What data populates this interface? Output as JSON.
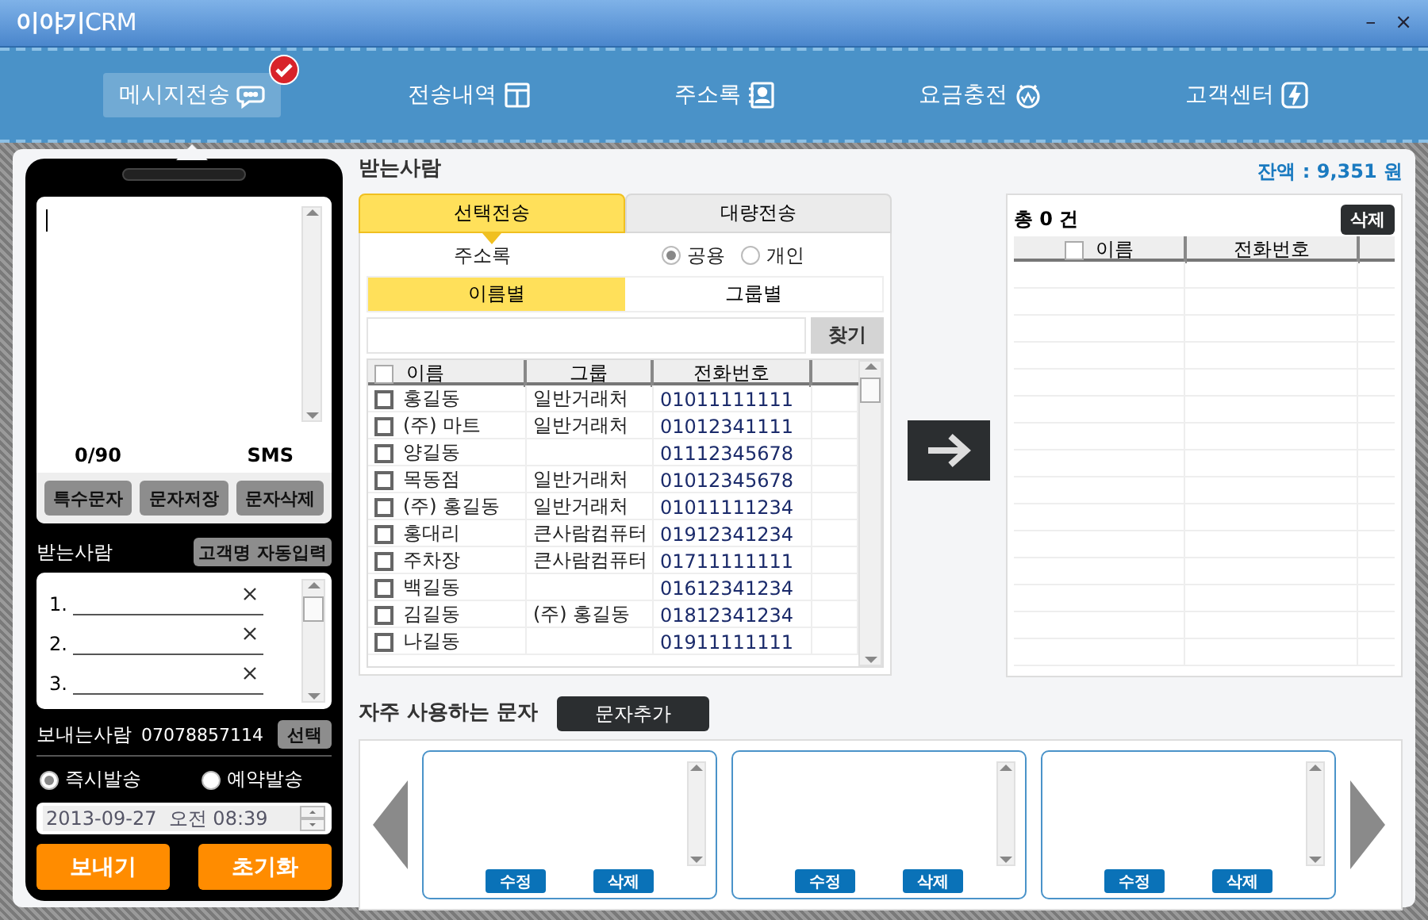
{
  "window": {
    "title": "**이야기**CRM",
    "controls": [
      "–",
      "×"
    ]
  },
  "nav": [
    {
      "label": "메시지전송",
      "selected": true
    },
    {
      "label": "전송내역",
      "selected": false
    },
    {
      "label": "주소록",
      "selected": false
    },
    {
      "label": "요금충전",
      "selected": false
    },
    {
      "label": "고객센터",
      "selected": false
    }
  ],
  "composer": {
    "counter": "0/90",
    "mode": "SMS",
    "buttons": [
      "특수문자",
      "문자저장",
      "문자삭제"
    ]
  },
  "recipients": {
    "title": "받는사람",
    "auto_button": "고객명 자동입력",
    "slots": [
      "1.",
      "2.",
      "3."
    ]
  },
  "sender": {
    "label": "보내는사람",
    "number": "07078857114",
    "button": "선택"
  },
  "send_timing": [
    {
      "label": "즉시발송",
      "selected": true
    },
    {
      "label": "예약발송",
      "selected": false
    }
  ],
  "schedule": {
    "value": "2013-09-27  오전 08:39"
  },
  "actions": [
    {
      "label": "보내기"
    },
    {
      "label": "초기화"
    }
  ],
  "address": {
    "title": "받는사람",
    "tabs": [
      {
        "label": "선택전송",
        "selected": true
      },
      {
        "label": "대량전송",
        "selected": false
      }
    ],
    "book_label": "주소록",
    "scope": [
      {
        "label": "공용",
        "selected": true
      },
      {
        "label": "개인",
        "selected": false
      }
    ],
    "sort_tabs": [
      {
        "label": "이름별",
        "selected": true
      },
      {
        "label": "그룹별",
        "selected": false
      }
    ],
    "search_button": "찾기",
    "columns": [
      "이름",
      "그룹",
      "전화번호"
    ],
    "all_checked": false,
    "rows": [
      {
        "name": "홍길동",
        "group": "일반거래처",
        "phone": "01011111111",
        "checked": false
      },
      {
        "name": "(주) 마트",
        "group": "일반거래처",
        "phone": "01012341111",
        "checked": false
      },
      {
        "name": "양길동",
        "group": "",
        "phone": "01112345678",
        "checked": false
      },
      {
        "name": "목동점",
        "group": "일반거래처",
        "phone": "01012345678",
        "checked": false
      },
      {
        "name": "(주) 홍길동",
        "group": "일반거래처",
        "phone": "01011111234",
        "checked": false
      },
      {
        "name": "홍대리",
        "group": "큰사람컴퓨터",
        "phone": "01912341234",
        "checked": false
      },
      {
        "name": "주차장",
        "group": "큰사람컴퓨터",
        "phone": "01711111111",
        "checked": false
      },
      {
        "name": "백길동",
        "group": "",
        "phone": "01612341234",
        "checked": false
      },
      {
        "name": "김길동",
        "group": "(주) 홍길동",
        "phone": "01812341234",
        "checked": false
      },
      {
        "name": "나길동",
        "group": "",
        "phone": "01911111111",
        "checked": false
      }
    ]
  },
  "selected_list": {
    "balance": "잔액 : 9,351 원",
    "total": "총 0 건",
    "delete_button": "삭제",
    "columns": [
      "이름",
      "전화번호"
    ],
    "all_checked": false
  },
  "frequent": {
    "title": "자주 사용하는 문자",
    "add_button": "문자추가",
    "cards": [
      {
        "buttons": [
          "수정",
          "삭제"
        ]
      },
      {
        "buttons": [
          "수정",
          "삭제"
        ]
      },
      {
        "buttons": [
          "수정",
          "삭제"
        ]
      }
    ]
  }
}
